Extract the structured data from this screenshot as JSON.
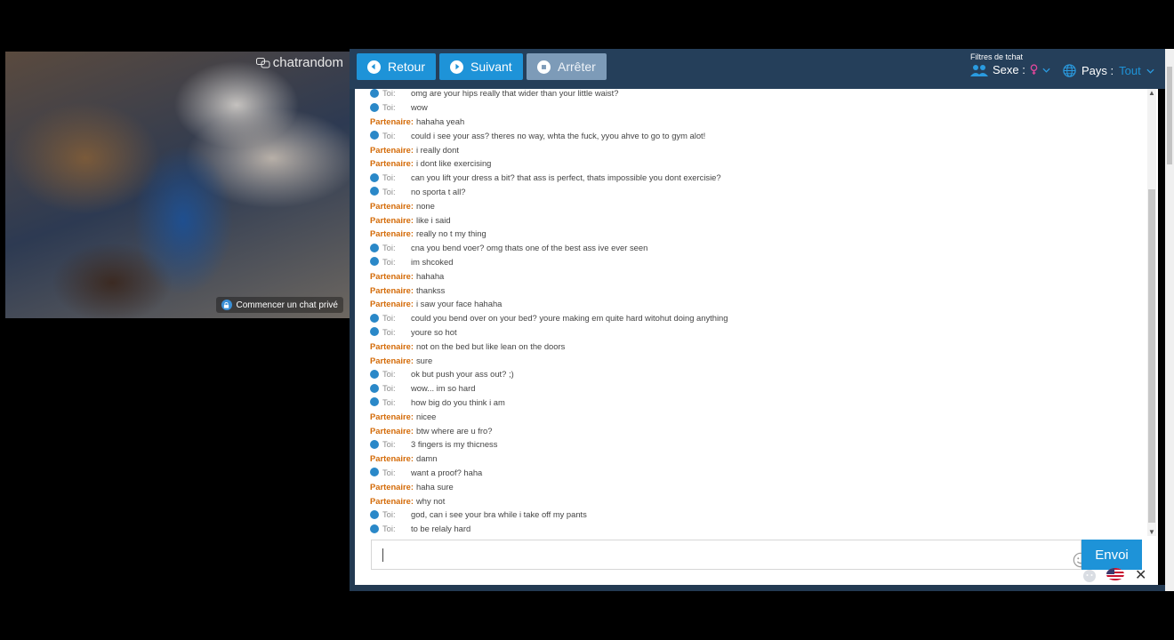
{
  "video": {
    "logo_text": "chatrandom",
    "private_chat_label": "Commencer un chat privé"
  },
  "toolbar": {
    "back_label": "Retour",
    "next_label": "Suivant",
    "stop_label": "Arrêter"
  },
  "filters": {
    "title": "Filtres de tchat",
    "sex_label": "Sexe :",
    "country_label": "Pays :",
    "country_value": "Tout"
  },
  "chat": {
    "me_label": "Toi:",
    "partner_label": "Partenaire:",
    "messages": [
      {
        "from": "me",
        "text": "omg are your hips really that wider than your little waist?"
      },
      {
        "from": "me",
        "text": "wow"
      },
      {
        "from": "partner",
        "text": "hahaha yeah"
      },
      {
        "from": "me",
        "text": "could i see your ass? theres no way, whta the fuck, yyou ahve to go to gym alot!"
      },
      {
        "from": "partner",
        "text": "i really dont"
      },
      {
        "from": "partner",
        "text": "i dont like exercising"
      },
      {
        "from": "me",
        "text": "can you lift your dress a bit? that ass is perfect, thats impossible you dont exercisie?"
      },
      {
        "from": "me",
        "text": "no sporta t all?"
      },
      {
        "from": "partner",
        "text": "none"
      },
      {
        "from": "partner",
        "text": "like i said"
      },
      {
        "from": "partner",
        "text": "really no t my thing"
      },
      {
        "from": "me",
        "text": "cna you bend voer? omg thats one of the best ass ive ever seen"
      },
      {
        "from": "me",
        "text": "im shcoked"
      },
      {
        "from": "partner",
        "text": "hahaha"
      },
      {
        "from": "partner",
        "text": "thankss"
      },
      {
        "from": "partner",
        "text": "i saw your face hahaha"
      },
      {
        "from": "me",
        "text": "could you bend over on your bed? youre making em quite hard witohut doing anything"
      },
      {
        "from": "me",
        "text": "youre so hot"
      },
      {
        "from": "partner",
        "text": "not on the bed but like lean on the doors"
      },
      {
        "from": "partner",
        "text": "sure"
      },
      {
        "from": "me",
        "text": "ok but push your ass out? ;)"
      },
      {
        "from": "me",
        "text": "wow... im so hard"
      },
      {
        "from": "me",
        "text": "how big do you think i am"
      },
      {
        "from": "partner",
        "text": "nicee"
      },
      {
        "from": "partner",
        "text": "btw where are u fro?"
      },
      {
        "from": "me",
        "text": "3 fingers is my thicness"
      },
      {
        "from": "partner",
        "text": "damn"
      },
      {
        "from": "me",
        "text": "want a proof? haha"
      },
      {
        "from": "partner",
        "text": "haha sure"
      },
      {
        "from": "partner",
        "text": "why not"
      },
      {
        "from": "me",
        "text": "god, can i see your bra while i take off my pants"
      },
      {
        "from": "me",
        "text": "to be relaly hard"
      }
    ]
  },
  "composer": {
    "input_value": "",
    "send_label": "Envoi"
  },
  "colors": {
    "accent": "#1e93d8",
    "topbar": "#253f5a",
    "partner": "#d46b08",
    "sex_female": "#e0479a"
  }
}
